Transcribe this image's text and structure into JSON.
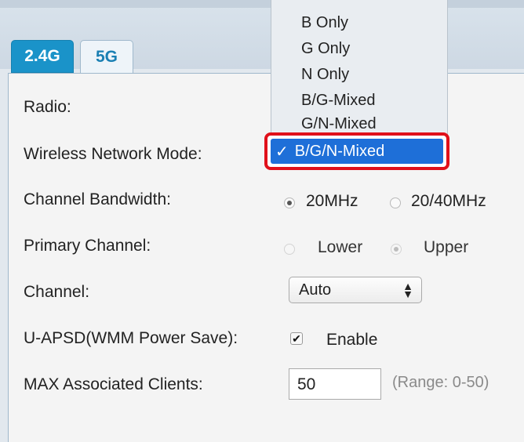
{
  "tabs": [
    {
      "label": "2.4G",
      "active": true
    },
    {
      "label": "5G",
      "active": false
    }
  ],
  "form": {
    "radio_label": "Radio:",
    "mode_label": "Wireless Network Mode:",
    "bandwidth": {
      "label": "Channel Bandwidth:",
      "options": [
        "20MHz",
        "20/40MHz"
      ],
      "selected": "20MHz"
    },
    "primary_channel": {
      "label": "Primary Channel:",
      "options": [
        "Lower",
        "Upper"
      ],
      "selected": "Upper",
      "disabled": true
    },
    "channel": {
      "label": "Channel:",
      "value": "Auto"
    },
    "uapsd": {
      "label": "U-APSD(WMM Power Save):",
      "checkbox_label": "Enable",
      "checked": true
    },
    "max_clients": {
      "label": "MAX Associated Clients:",
      "value": "50",
      "hint": "(Range: 0-50)"
    }
  },
  "mode_dropdown": {
    "options": [
      "B Only",
      "G Only",
      "N Only",
      "B/G-Mixed",
      "G/N-Mixed",
      "B/G/N-Mixed"
    ],
    "selected": "B/G/N-Mixed",
    "check_mark": "✓",
    "highlight_color": "#e0101a",
    "selection_color": "#1e6fd8"
  },
  "colors": {
    "active_tab": "#1a93c9",
    "inactive_tab_text": "#1a7fb3"
  }
}
